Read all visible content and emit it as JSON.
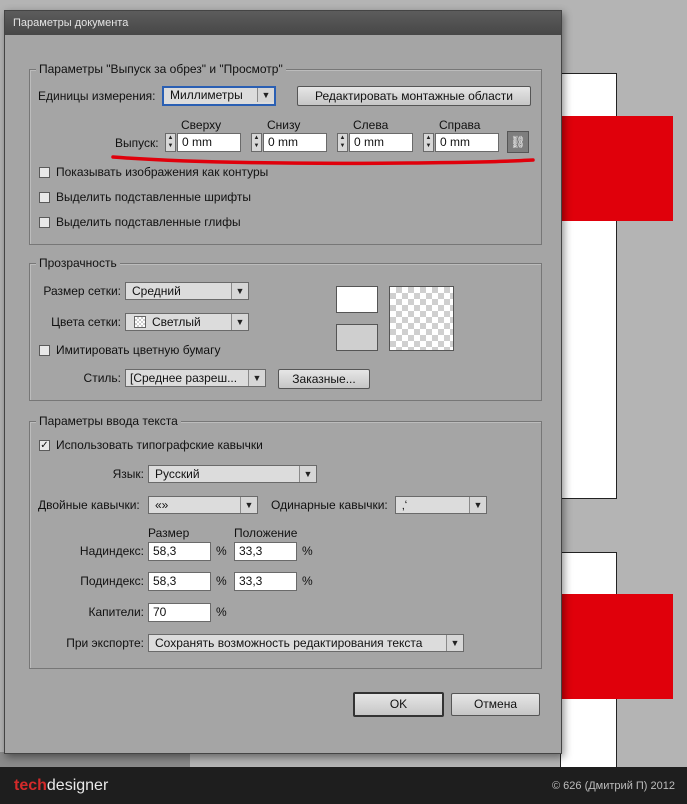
{
  "dialog": {
    "title": "Параметры документа",
    "ok_label": "OK",
    "cancel_label": "Отмена"
  },
  "bleed_group": {
    "title": "Параметры \"Выпуск за обрез\" и \"Просмотр\"",
    "units_label": "Единицы измерения:",
    "units_value": "Миллиметры",
    "edit_artboards_label": "Редактировать монтажные области",
    "bleed_label": "Выпуск:",
    "top_label": "Сверху",
    "bottom_label": "Снизу",
    "left_label": "Слева",
    "right_label": "Справа",
    "top_value": "0 mm",
    "bottom_value": "0 mm",
    "left_value": "0 mm",
    "right_value": "0 mm",
    "show_images_outline": "Показывать изображения как контуры",
    "highlight_fonts": "Выделить подставленные шрифты",
    "highlight_glyphs": "Выделить подставленные глифы"
  },
  "transparency_group": {
    "title": "Прозрачность",
    "grid_size_label": "Размер сетки:",
    "grid_size_value": "Средний",
    "grid_colors_label": "Цвета сетки:",
    "grid_colors_value": "Светлый",
    "simulate_paper": "Имитировать цветную бумагу",
    "style_label": "Стиль:",
    "style_value": "[Среднее разреш...",
    "custom_label": "Заказные..."
  },
  "text_group": {
    "title": "Параметры ввода текста",
    "typographic_quotes": "Использовать типографские кавычки",
    "language_label": "Язык:",
    "language_value": "Русский",
    "double_quotes_label": "Двойные кавычки:",
    "double_quotes_value": "«»",
    "single_quotes_label": "Одинарные кавычки:",
    "single_quotes_value": "‚‘",
    "size_header": "Размер",
    "position_header": "Положение",
    "superscript_label": "Надиндекс:",
    "superscript_size": "58,3",
    "superscript_position": "33,3",
    "subscript_label": "Подиндекс:",
    "subscript_size": "58,3",
    "subscript_position": "33,3",
    "smallcaps_label": "Капители:",
    "smallcaps_value": "70",
    "percent": "%",
    "export_label": "При экспорте:",
    "export_value": "Сохранять возможность редактирования текста"
  },
  "footer": {
    "logo_tech": "tech",
    "logo_designer": "designer",
    "copyright": "© 626 (Дмитрий П) 2012"
  },
  "colors": {
    "accent_underline": "#e0000b",
    "focus_border": "#2a5fb3"
  }
}
